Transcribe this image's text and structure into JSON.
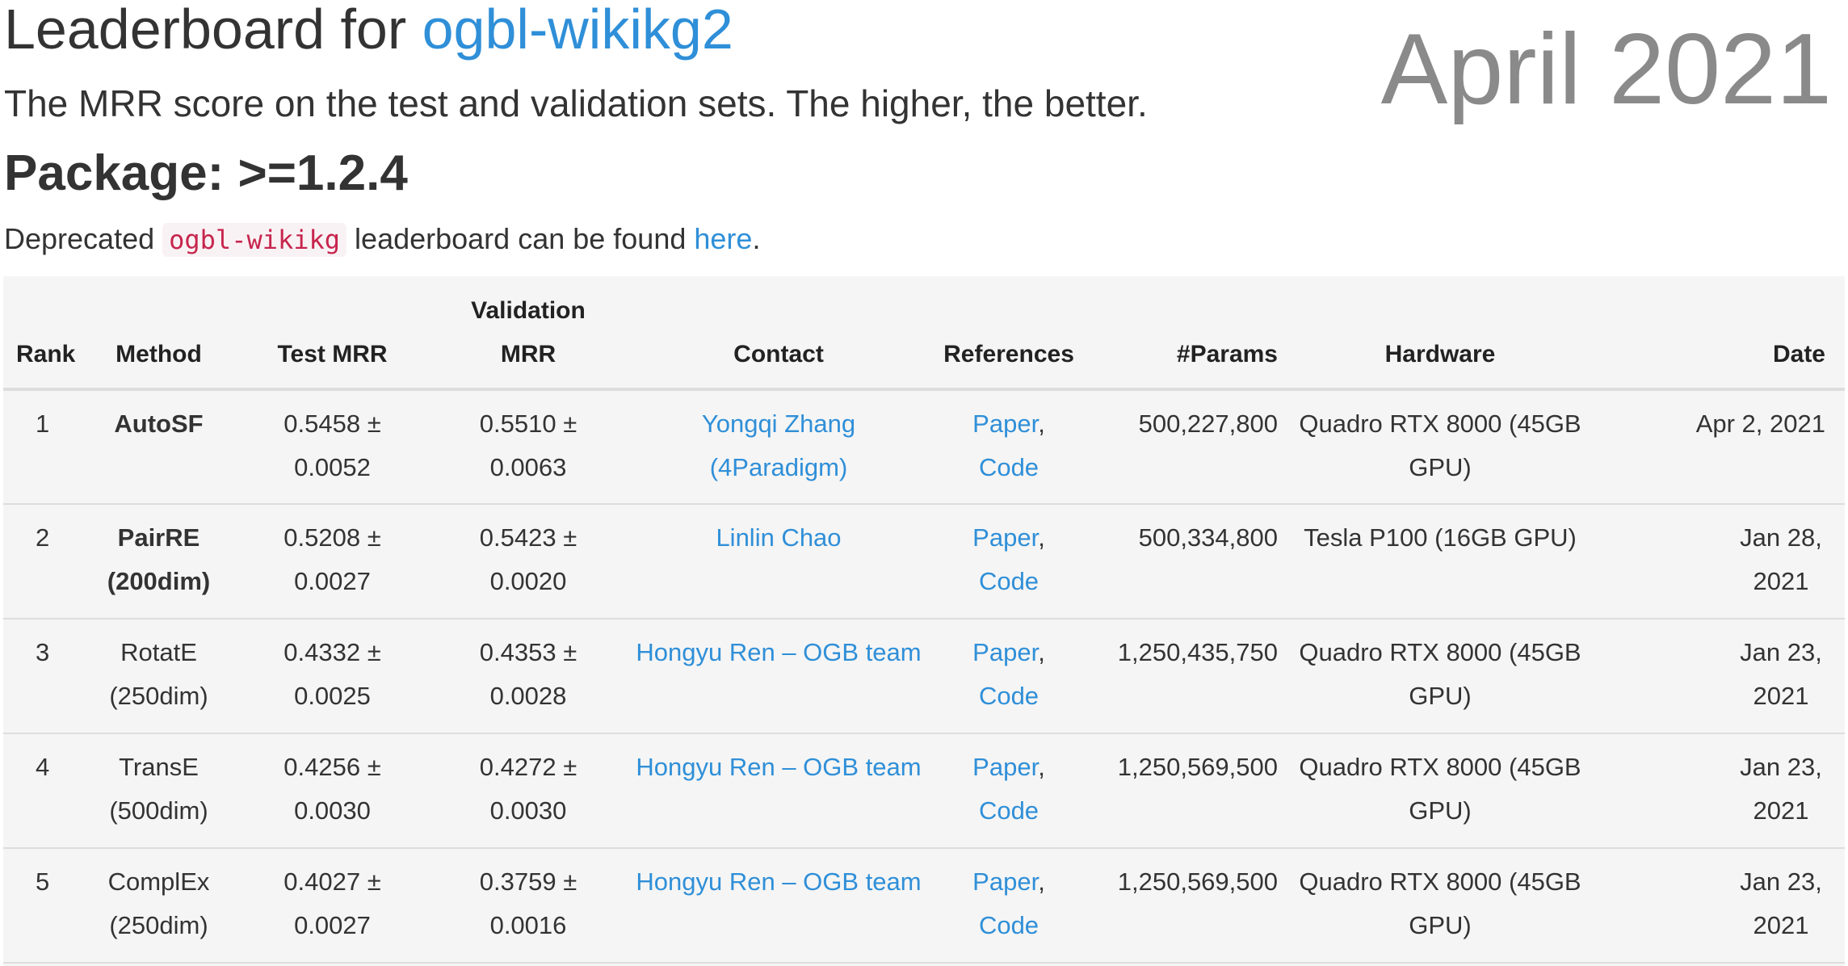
{
  "header": {
    "title_prefix": "Leaderboard for ",
    "dataset_link": "ogbl-wikikg2",
    "subtitle": "The MRR score on the test and validation sets. The higher, the better.",
    "package": "Package: >=1.2.4",
    "deprecated_prefix": "Deprecated ",
    "deprecated_code": "ogbl-wikikg",
    "deprecated_middle": " leaderboard can be found ",
    "deprecated_link": "here",
    "deprecated_suffix": ".",
    "date_stamp": "April 2021"
  },
  "table": {
    "headers": {
      "rank": "Rank",
      "method": "Method",
      "test_mrr": "Test MRR",
      "validation_mrr_line1": "Validation",
      "validation_mrr_line2": "MRR",
      "contact": "Contact",
      "references": "References",
      "params": "#Params",
      "hardware": "Hardware",
      "date": "Date"
    },
    "rows": [
      {
        "rank": "1",
        "method": "AutoSF",
        "method_bold": true,
        "test_mrr": "0.5458 ± 0.0052",
        "validation_mrr": "0.5510 ± 0.0063",
        "contact": "Yongqi Zhang (4Paradigm)",
        "paper": "Paper",
        "ref_sep": ",",
        "code": "Code",
        "params": "500,227,800",
        "hardware": "Quadro RTX 8000 (45GB GPU)",
        "date": "Apr 2, 2021"
      },
      {
        "rank": "2",
        "method": "PairRE (200dim)",
        "method_bold": true,
        "test_mrr": "0.5208 ± 0.0027",
        "validation_mrr": "0.5423 ± 0.0020",
        "contact": "Linlin Chao",
        "paper": "Paper",
        "ref_sep": ",",
        "code": "Code",
        "params": "500,334,800",
        "hardware": "Tesla P100 (16GB GPU)",
        "date": "Jan 28, 2021"
      },
      {
        "rank": "3",
        "method": "RotatE (250dim)",
        "method_bold": false,
        "test_mrr": "0.4332 ± 0.0025",
        "validation_mrr": "0.4353 ± 0.0028",
        "contact": "Hongyu Ren – OGB team",
        "paper": "Paper",
        "ref_sep": ",",
        "code": "Code",
        "params": "1,250,435,750",
        "hardware": "Quadro RTX 8000 (45GB GPU)",
        "date": "Jan 23, 2021"
      },
      {
        "rank": "4",
        "method": "TransE (500dim)",
        "method_bold": false,
        "test_mrr": "0.4256 ± 0.0030",
        "validation_mrr": "0.4272 ± 0.0030",
        "contact": "Hongyu Ren – OGB team",
        "paper": "Paper",
        "ref_sep": ",",
        "code": "Code",
        "params": "1,250,569,500",
        "hardware": "Quadro RTX 8000 (45GB GPU)",
        "date": "Jan 23, 2021"
      },
      {
        "rank": "5",
        "method": "ComplEx (250dim)",
        "method_bold": false,
        "test_mrr": "0.4027 ± 0.0027",
        "validation_mrr": "0.3759 ± 0.0016",
        "contact": "Hongyu Ren – OGB team",
        "paper": "Paper",
        "ref_sep": ",",
        "code": "Code",
        "params": "1,250,569,500",
        "hardware": "Quadro RTX 8000 (45GB GPU)",
        "date": "Jan 23, 2021"
      }
    ]
  },
  "colors": {
    "link": "#2f8fd8",
    "text": "#333333",
    "date_stamp": "#8a8a8a",
    "code_text": "#c7254e",
    "code_bg": "#f9f2f4",
    "table_bg": "#f5f5f5"
  }
}
